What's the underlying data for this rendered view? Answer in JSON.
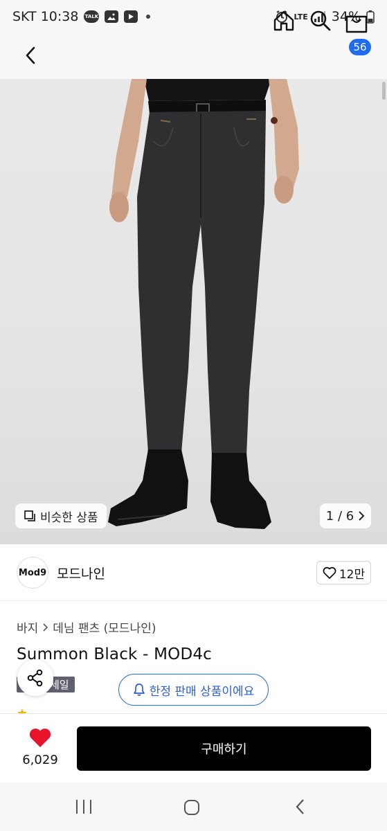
{
  "status_bar": {
    "carrier_time": "SKT 10:38",
    "talk_icon": "TALK",
    "battery": "34%",
    "network": "LTE"
  },
  "nav": {
    "cart_count": "56"
  },
  "gallery": {
    "similar_label": "비슷한 상품",
    "page": "1 / 6"
  },
  "brand": {
    "logo_text": "Mod9",
    "name": "모드나인",
    "likes": "12만"
  },
  "breadcrumb": {
    "category": "바지",
    "subcategory": "데님 팬츠 (모드나인)"
  },
  "product": {
    "title": "Summon Black - MOD4c",
    "sale_tag": "세일",
    "limited_notice": "한정 판매 상품이에요"
  },
  "purchase": {
    "wish_count": "6,029",
    "buy_label": "구매하기"
  },
  "colors": {
    "accent_blue": "#1f6cf0",
    "pill_blue": "#2d6cdf",
    "heart_red": "#e8142b",
    "buy_black": "#000000"
  },
  "icons": [
    "back-icon",
    "home-icon",
    "search-icon",
    "cart-icon",
    "share-icon",
    "heart-icon",
    "bell-icon",
    "copy-icon"
  ]
}
